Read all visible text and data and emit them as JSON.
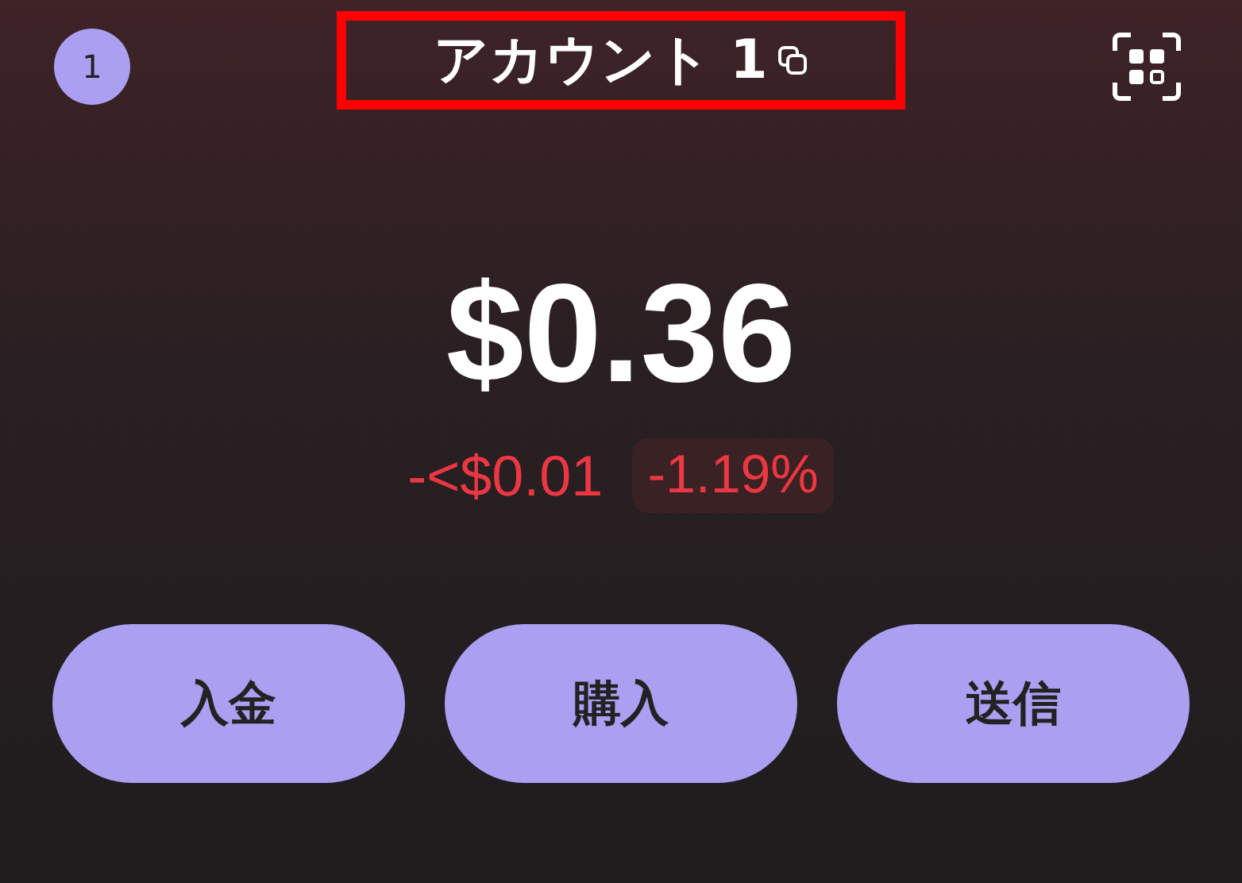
{
  "header": {
    "account_badge": "1",
    "title": "アカウント 1",
    "highlighted": true
  },
  "balance": {
    "amount": "$0.36",
    "change": "-<$0.01",
    "change_percent": "-1.19%",
    "negative": true
  },
  "actions": [
    {
      "label": "入金"
    },
    {
      "label": "購入"
    },
    {
      "label": "送信"
    }
  ]
}
